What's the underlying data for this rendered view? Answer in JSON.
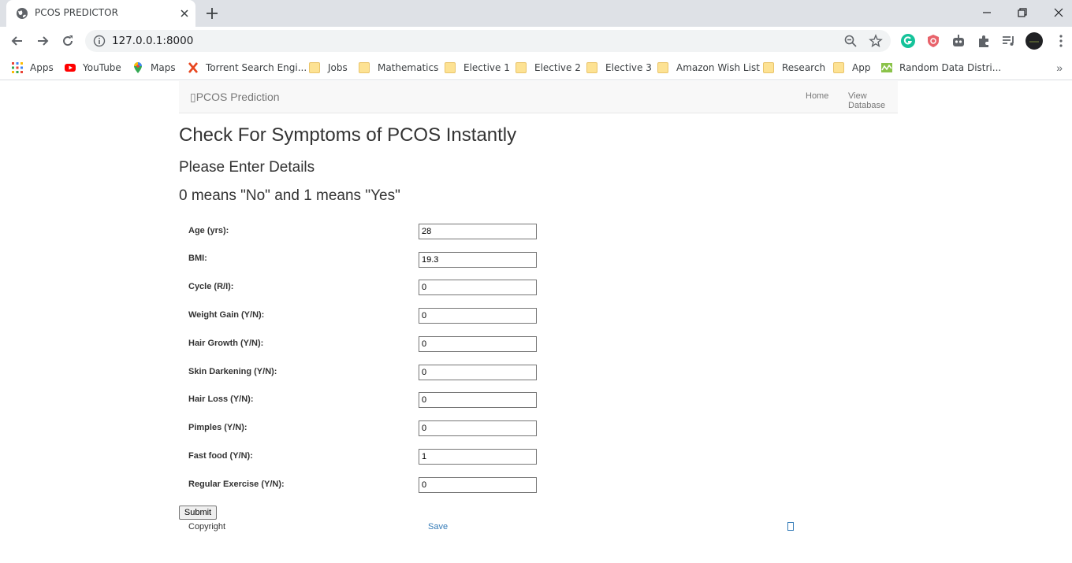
{
  "browser": {
    "tab_title": "PCOS PREDICTOR",
    "url": "127.0.0.1:8000",
    "bookmarks": [
      {
        "label": "Apps",
        "icon": "apps-grid-icon"
      },
      {
        "label": "YouTube",
        "icon": "youtube-icon"
      },
      {
        "label": "Maps",
        "icon": "maps-pin-icon"
      },
      {
        "label": "Torrent Search Engi...",
        "icon": "torrent-x-icon"
      },
      {
        "label": "Jobs",
        "icon": "folder-icon"
      },
      {
        "label": "Mathematics",
        "icon": "folder-icon"
      },
      {
        "label": "Elective 1",
        "icon": "folder-icon"
      },
      {
        "label": "Elective 2",
        "icon": "folder-icon"
      },
      {
        "label": "Elective 3",
        "icon": "folder-icon"
      },
      {
        "label": "Amazon Wish List",
        "icon": "folder-icon"
      },
      {
        "label": "Research",
        "icon": "folder-icon"
      },
      {
        "label": "App",
        "icon": "folder-icon"
      },
      {
        "label": "Random Data Distri...",
        "icon": "chart-icon"
      }
    ],
    "bookmarks_more": "»"
  },
  "navbar": {
    "brand": "PCOS Prediction",
    "links": [
      "Home",
      "View Database"
    ]
  },
  "headings": {
    "title": "Check For Symptoms of PCOS Instantly",
    "subtitle": "Please Enter Details",
    "hint": "0 means \"No\" and 1 means \"Yes\""
  },
  "form": {
    "fields": [
      {
        "label": "Age (yrs):",
        "value": "28"
      },
      {
        "label": "BMI:",
        "value": "19.3"
      },
      {
        "label": "Cycle (R/I):",
        "value": "0"
      },
      {
        "label": "Weight Gain (Y/N):",
        "value": "0"
      },
      {
        "label": "Hair Growth (Y/N):",
        "value": "0"
      },
      {
        "label": "Skin Darkening (Y/N):",
        "value": "0"
      },
      {
        "label": "Hair Loss (Y/N):",
        "value": "0"
      },
      {
        "label": "Pimples (Y/N):",
        "value": "0"
      },
      {
        "label": "Fast food (Y/N):",
        "value": "1"
      },
      {
        "label": "Regular Exercise (Y/N):",
        "value": "0"
      }
    ],
    "submit_label": "Submit"
  },
  "footer": {
    "copyright": "Copyright",
    "save": "Save"
  },
  "colors": {
    "link": "#337ab7",
    "navbar_bg": "#f8f8f8",
    "text": "#333333"
  }
}
